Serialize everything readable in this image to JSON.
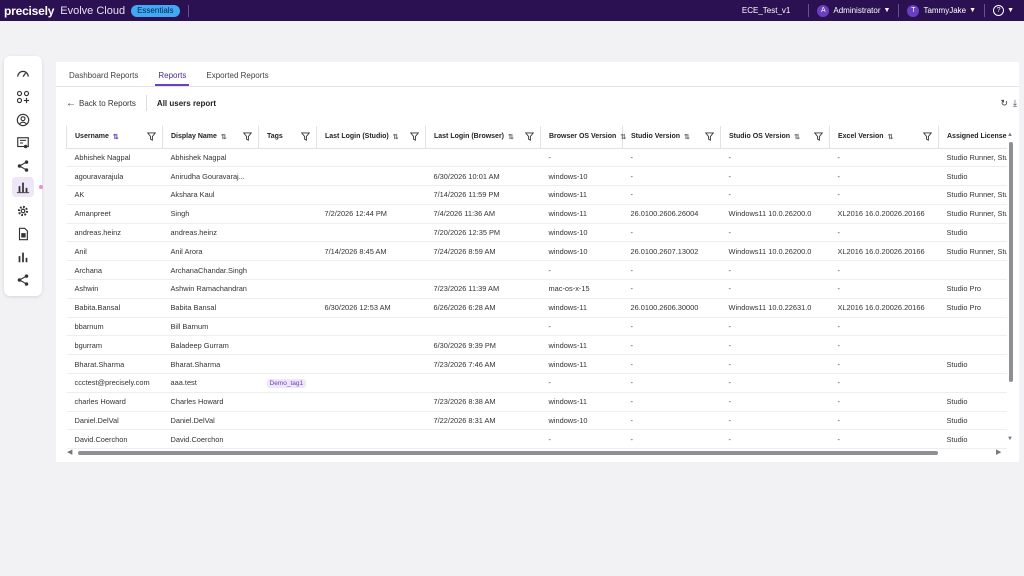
{
  "topbar": {
    "brand_main": "precisely",
    "product": "Evolve Cloud",
    "plan_badge": "Essentials",
    "environment": "ECE_Test_v1",
    "role_initial": "A",
    "role": "Administrator",
    "user_initial": "T",
    "user": "TammyJake"
  },
  "tabs": [
    "Dashboard Reports",
    "Reports",
    "Exported Reports"
  ],
  "subhead": {
    "back_label": "Back to Reports",
    "title": "All users report"
  },
  "table": {
    "columns": [
      "Username",
      "Display Name",
      "Tags",
      "Last Login (Studio)",
      "Last Login (Browser)",
      "Browser OS Version",
      "Studio Version",
      "Studio OS Version",
      "Excel Version",
      "Assigned License"
    ],
    "rows": [
      [
        "Abhishek Nagpal",
        "Abhishek Nagpal",
        "",
        "",
        "",
        "-",
        "-",
        "-",
        "-",
        "Studio Runner, Stu"
      ],
      [
        "agouravarajula",
        "Anirudha Gouravaraj...",
        "",
        "",
        "6/30/2026 10:01 AM",
        "windows-10",
        "-",
        "-",
        "-",
        "Studio"
      ],
      [
        "AK",
        "Akshara Kaul",
        "",
        "",
        "7/14/2026 11:59 PM",
        "windows-11",
        "-",
        "-",
        "-",
        "Studio Runner, Stu"
      ],
      [
        "Amanpreet",
        "Singh",
        "",
        "7/2/2026 12:44 PM",
        "7/4/2026 11:36 AM",
        "windows-11",
        "26.0100.2606.26004",
        "Windows11 10.0.26200.0",
        "XL2016 16.0.20026.20166",
        "Studio Runner, Stu"
      ],
      [
        "andreas.heinz",
        "andreas.heinz",
        "",
        "",
        "7/20/2026 12:35 PM",
        "windows-10",
        "-",
        "-",
        "-",
        "Studio"
      ],
      [
        "Anil",
        "Anil Arora",
        "",
        "7/14/2026 8:45 AM",
        "7/24/2026 8:59 AM",
        "windows-10",
        "26.0100.2607.13002",
        "Windows11 10.0.26200.0",
        "XL2016 16.0.20026.20166",
        "Studio Runner, Stu"
      ],
      [
        "Archana",
        "ArchanaChandar.Singh",
        "",
        "",
        "",
        "-",
        "-",
        "-",
        "-",
        ""
      ],
      [
        "Ashwin",
        "Ashwin Ramachandran",
        "",
        "",
        "7/23/2026 11:39 AM",
        "mac-os-x-15",
        "-",
        "-",
        "-",
        "Studio Pro"
      ],
      [
        "Babita.Bansal",
        "Babita Bansal",
        "",
        "6/30/2026 12:53 AM",
        "6/26/2026 6:28 AM",
        "windows-11",
        "26.0100.2606.30000",
        "Windows11 10.0.22631.0",
        "XL2016 16.0.20026.20166",
        "Studio Pro"
      ],
      [
        "bbarnum",
        "Bill Barnum",
        "",
        "",
        "",
        "-",
        "-",
        "-",
        "-",
        ""
      ],
      [
        "bgurram",
        "Baladeep Gurram",
        "",
        "",
        "6/30/2026 9:39 PM",
        "windows-11",
        "-",
        "-",
        "-",
        ""
      ],
      [
        "Bharat.Sharma",
        "Bharat.Sharma",
        "",
        "",
        "7/23/2026 7:46 AM",
        "windows-11",
        "-",
        "-",
        "-",
        "Studio"
      ],
      [
        "ccctest@precisely.com",
        "aaa.test",
        "Demo_tag1",
        "",
        "",
        "-",
        "-",
        "-",
        "-",
        ""
      ],
      [
        "charles Howard",
        "Charles Howard",
        "",
        "",
        "7/23/2026 8:38 AM",
        "windows-11",
        "-",
        "-",
        "-",
        "Studio"
      ],
      [
        "Daniel.DelVal",
        "Daniel.DelVal",
        "",
        "",
        "7/22/2026 8:31 AM",
        "windows-10",
        "-",
        "-",
        "-",
        "Studio"
      ],
      [
        "David.Coerchon",
        "David.Coerchon",
        "",
        "",
        "",
        "-",
        "-",
        "-",
        "-",
        "Studio"
      ]
    ]
  },
  "colors": {
    "topbar": "#2b1152",
    "accent": "#6a3fc1",
    "tag_bg": "#efe6fb"
  }
}
